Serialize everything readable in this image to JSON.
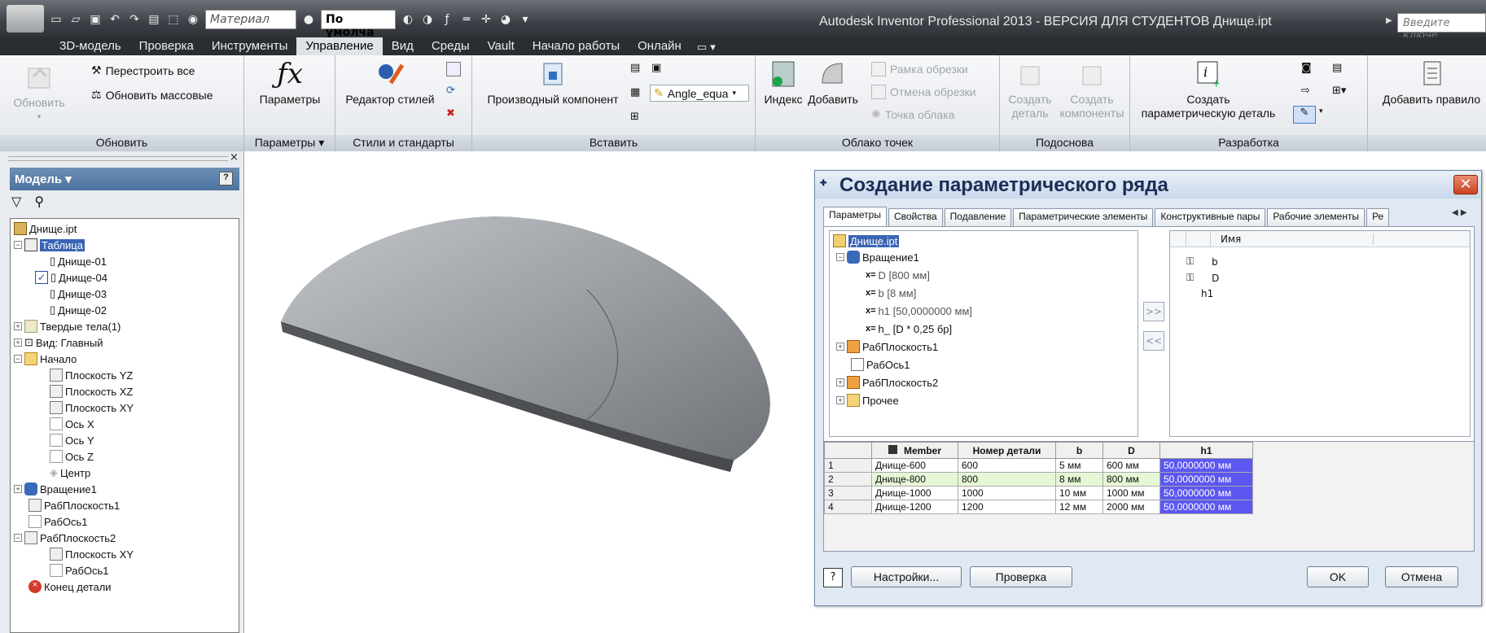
{
  "titlebar": {
    "material_combo": "Материал",
    "appearance_combo": "По умолча",
    "window_title": "Autodesk Inventor Professional 2013 - ВЕРСИЯ ДЛЯ СТУДЕНТОВ   Днище.ipt",
    "help_search_placeholder": "Введите ключе"
  },
  "menu": {
    "tabs": [
      "3D-модель",
      "Проверка",
      "Инструменты",
      "Управление",
      "Вид",
      "Среды",
      "Vault",
      "Начало работы",
      "Онлайн"
    ],
    "active": "Управление"
  },
  "ribbon": {
    "update_panel": {
      "update_label": "Обновить",
      "rebuild_all": "Перестроить все",
      "update_mass": "Обновить массовые",
      "panel_label": "Обновить"
    },
    "params_panel": {
      "params_label": "Параметры",
      "panel_label": "Параметры ▾"
    },
    "styles_panel": {
      "editor_label": "Редактор стилей",
      "panel_label": "Стили и стандарты"
    },
    "insert_panel": {
      "derived_label": "Производный компонент",
      "combo_value": "Angle_equa",
      "panel_label": "Вставить"
    },
    "cloud_panel": {
      "index_label": "Индекс",
      "add_label": "Добавить",
      "crop_frame": "Рамка обрезки",
      "cancel_crop": "Отмена обрезки",
      "cloud_point": "Точка облака",
      "panel_label": "Облако точек"
    },
    "subbase_panel": {
      "create_part_1": "Создать",
      "create_part_2": "деталь",
      "create_comp_1": "Создать",
      "create_comp_2": "компоненты",
      "panel_label": "Подоснова"
    },
    "dev_panel": {
      "create_param_1": "Создать",
      "create_param_2": "параметрическую деталь",
      "panel_label": "Разработка"
    },
    "rules_panel": {
      "add_rule": "Добавить правило"
    }
  },
  "browser": {
    "header": "Модель ▾",
    "tree": [
      {
        "label": "Днище.ipt"
      },
      {
        "label": "Таблица"
      },
      {
        "label": "Днище-01"
      },
      {
        "label": "Днище-04"
      },
      {
        "label": "Днище-03"
      },
      {
        "label": "Днище-02"
      },
      {
        "label": "Твердые тела(1)"
      },
      {
        "label": "Вид: Главный"
      },
      {
        "label": "Начало"
      },
      {
        "label": "Плоскость YZ"
      },
      {
        "label": "Плоскость XZ"
      },
      {
        "label": "Плоскость XY"
      },
      {
        "label": "Ось X"
      },
      {
        "label": "Ось Y"
      },
      {
        "label": "Ось Z"
      },
      {
        "label": "Центр"
      },
      {
        "label": "Вращение1"
      },
      {
        "label": "РабПлоскость1"
      },
      {
        "label": "РабОсь1"
      },
      {
        "label": "РабПлоскость2"
      },
      {
        "label": "Плоскость XY"
      },
      {
        "label": "РабОсь1"
      },
      {
        "label": "Конец детали"
      }
    ]
  },
  "dialog": {
    "title": "Создание параметрического ряда",
    "tabs": [
      "Параметры",
      "Свойства",
      "Подавление",
      "Параметрические элементы",
      "Конструктивные пары",
      "Рабочие элементы",
      "Ре"
    ],
    "param_tree": [
      "Днище.ipt",
      "Вращение1",
      "D [800 мм]",
      "b [8 мм]",
      "h1 [50,0000000 мм]",
      "h_ [D * 0,25 бр]",
      "РабПлоскость1",
      "РабОсь1",
      "РабПлоскость2",
      "Прочее"
    ],
    "add_btn": ">>",
    "remove_btn": "<<",
    "list_header": "Имя",
    "list_items": [
      "b",
      "D",
      "h1"
    ],
    "table": {
      "headers": [
        "Member",
        "Номер детали",
        "b",
        "D",
        "h1"
      ],
      "rows": [
        [
          "1",
          "Днище-600",
          "600",
          "5 мм",
          "600 мм",
          "50,0000000 мм"
        ],
        [
          "2",
          "Днище-800",
          "800",
          "8 мм",
          "800 мм",
          "50,0000000 мм"
        ],
        [
          "3",
          "Днище-1000",
          "1000",
          "10 мм",
          "1000 мм",
          "50,0000000 мм"
        ],
        [
          "4",
          "Днище-1200",
          "1200",
          "12 мм",
          "2000 мм",
          "50,0000000 мм"
        ]
      ]
    },
    "settings_btn": "Настройки...",
    "check_btn": "Проверка",
    "ok_btn": "OK",
    "cancel_btn": "Отмена"
  }
}
